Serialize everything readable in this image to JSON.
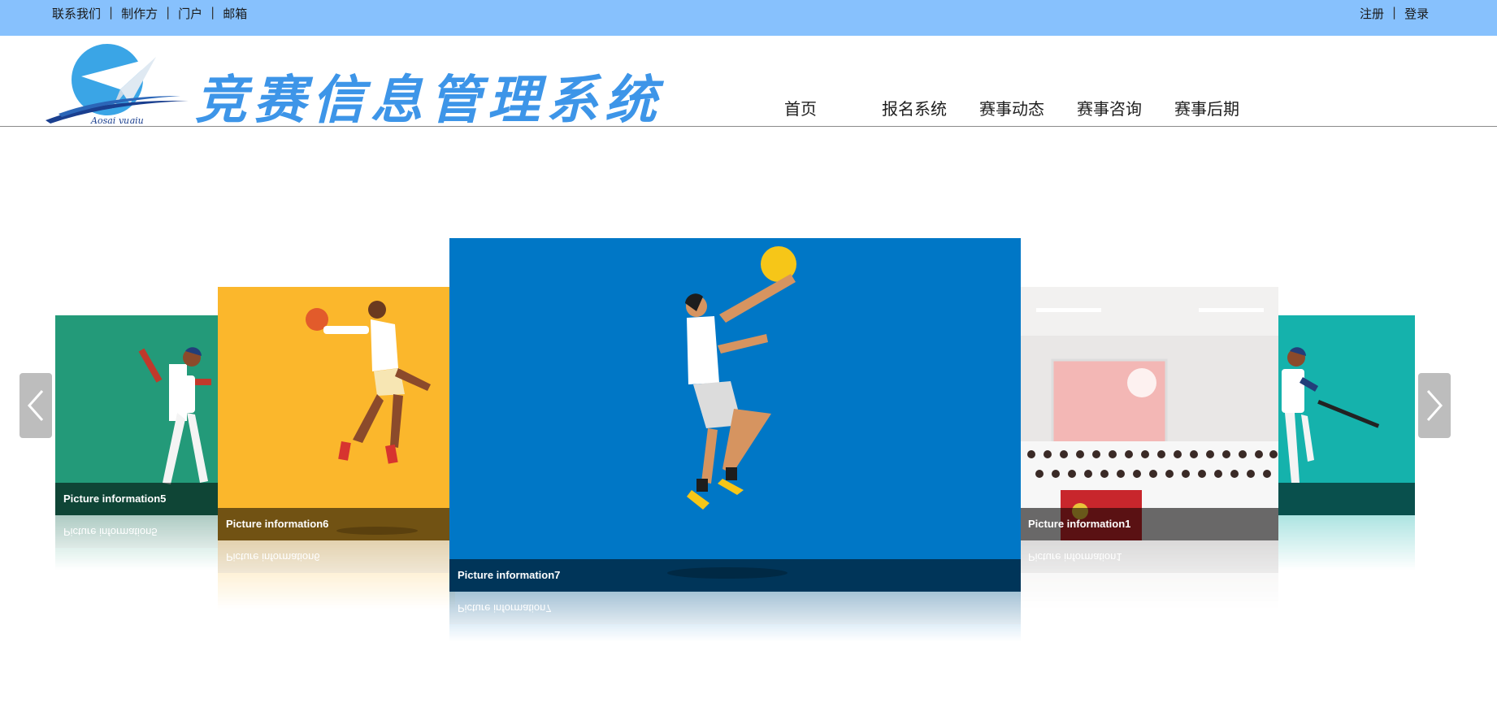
{
  "topbar": {
    "left_links": [
      "联系我们",
      "制作方",
      "门户",
      "邮箱"
    ],
    "right_links": [
      "注册",
      "登录"
    ],
    "separator": "|"
  },
  "header": {
    "brand": "竞赛信息管理系统",
    "logo_text": "Aosai yuqiu",
    "nav": [
      "首页",
      "报名系统",
      "赛事动态",
      "赛事咨询",
      "赛事后期"
    ]
  },
  "carousel": {
    "captions": {
      "far_left": "Picture information5",
      "left": "Picture information6",
      "center": "Picture information7",
      "right": "Picture information1"
    }
  },
  "colors": {
    "topbar": "#87c1fd",
    "brand": "#3d95e8",
    "card_green": "#239a79",
    "card_yellow": "#fbb72c",
    "card_blue": "#0077c6",
    "card_teal": "#15b2ac"
  }
}
